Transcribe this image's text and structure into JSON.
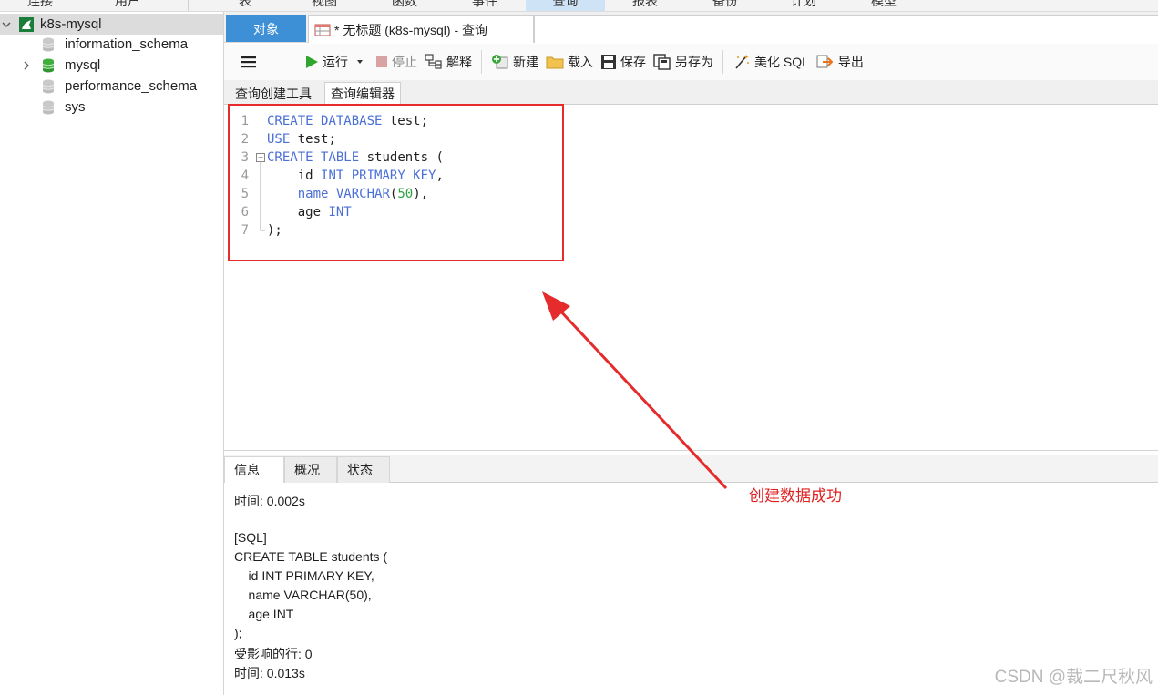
{
  "topmenu": [
    "连接",
    "用户",
    "表",
    "视图",
    "函数",
    "事件",
    "查询",
    "报表",
    "备份",
    "计划",
    "模型"
  ],
  "sidebar": {
    "connection": "k8s-mysql",
    "databases": [
      "information_schema",
      "mysql",
      "performance_schema",
      "sys"
    ]
  },
  "tabs": {
    "objects": "对象",
    "query": "* 无标题 (k8s-mysql) - 查询"
  },
  "toolbar": {
    "run": "运行",
    "stop": "停止",
    "explain": "解释",
    "new": "新建",
    "load": "载入",
    "save": "保存",
    "save_as": "另存为",
    "beautify": "美化 SQL",
    "export": "导出"
  },
  "subtabs": [
    "查询创建工具",
    "查询编辑器"
  ],
  "editor": {
    "lines": [
      {
        "n": "1",
        "parts": [
          [
            "kw",
            "CREATE"
          ],
          [
            "t",
            " "
          ],
          [
            "kw",
            "DATABASE"
          ],
          [
            "t",
            " test;"
          ]
        ]
      },
      {
        "n": "2",
        "parts": [
          [
            "kw",
            "USE"
          ],
          [
            "t",
            " test;"
          ]
        ]
      },
      {
        "n": "3",
        "parts": [
          [
            "kw",
            "CREATE"
          ],
          [
            "t",
            " "
          ],
          [
            "kw",
            "TABLE"
          ],
          [
            "t",
            " students ("
          ]
        ]
      },
      {
        "n": "4",
        "parts": [
          [
            "t",
            "    id "
          ],
          [
            "kw",
            "INT"
          ],
          [
            "t",
            " "
          ],
          [
            "kw",
            "PRIMARY"
          ],
          [
            "t",
            " "
          ],
          [
            "kw",
            "KEY"
          ],
          [
            "t",
            ","
          ]
        ]
      },
      {
        "n": "5",
        "parts": [
          [
            "t",
            "    "
          ],
          [
            "kw",
            "name"
          ],
          [
            "t",
            " "
          ],
          [
            "kw",
            "VARCHAR"
          ],
          [
            "t",
            "("
          ],
          [
            "num",
            "50"
          ],
          [
            "t",
            "),"
          ]
        ]
      },
      {
        "n": "6",
        "parts": [
          [
            "t",
            "    age "
          ],
          [
            "kw",
            "INT"
          ]
        ]
      },
      {
        "n": "7",
        "parts": [
          [
            "t",
            ");"
          ]
        ]
      }
    ]
  },
  "result": {
    "tabs": [
      "信息",
      "概况",
      "状态"
    ],
    "lines": [
      "时间: 0.002s",
      "",
      "[SQL]",
      "CREATE TABLE students (",
      "    id INT PRIMARY KEY,",
      "    name VARCHAR(50),",
      "    age INT",
      ");",
      "受影响的行: 0",
      "时间: 0.013s"
    ]
  },
  "annotation": "创建数据成功",
  "watermark": "CSDN @裁二尺秋风",
  "colors": {
    "accent_tab": "#3d8fd6",
    "keyword": "#4a6fd6",
    "annotation_red": "#e52b2b",
    "run_green": "#2fa52f"
  }
}
